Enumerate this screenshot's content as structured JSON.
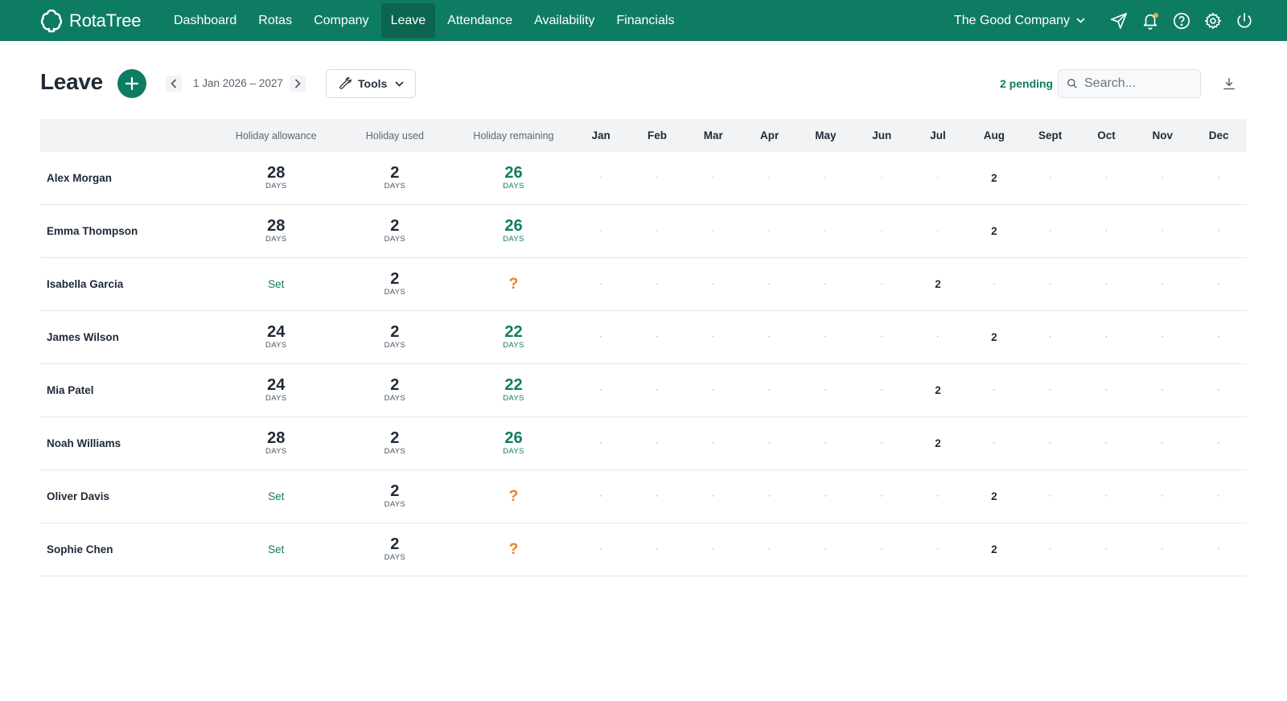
{
  "brand": {
    "name": "RotaTree"
  },
  "nav": [
    "Dashboard",
    "Rotas",
    "Company",
    "Leave",
    "Attendance",
    "Availability",
    "Financials"
  ],
  "nav_active": "Leave",
  "company": "The Good Company",
  "colors": {
    "brand": "#0e7c62",
    "accent_orange": "#e8831c",
    "notification_dot": "#f2a93b"
  },
  "page": {
    "title": "Leave",
    "period": "1 Jan 2026 – 2027",
    "tools_label": "Tools",
    "pending": "2 pending",
    "search_placeholder": "Search..."
  },
  "table": {
    "headers": {
      "allowance": "Holiday allowance",
      "used": "Holiday used",
      "remaining": "Holiday remaining"
    },
    "months": [
      "Jan",
      "Feb",
      "Mar",
      "Apr",
      "May",
      "Jun",
      "Jul",
      "Aug",
      "Sept",
      "Oct",
      "Nov",
      "Dec"
    ],
    "unit": "DAYS",
    "set_label": "Set",
    "unknown": "?",
    "empty": "·",
    "rows": [
      {
        "name": "Alex Morgan",
        "allowance": "28",
        "used": "2",
        "remaining": "26",
        "months": [
          "·",
          "·",
          "·",
          "·",
          "·",
          "·",
          "·",
          "2",
          "·",
          "·",
          "·",
          "·"
        ]
      },
      {
        "name": "Emma Thompson",
        "allowance": "28",
        "used": "2",
        "remaining": "26",
        "months": [
          "·",
          "·",
          "·",
          "·",
          "·",
          "·",
          "·",
          "2",
          "·",
          "·",
          "·",
          "·"
        ]
      },
      {
        "name": "Isabella Garcia",
        "allowance": null,
        "used": "2",
        "remaining": null,
        "months": [
          "·",
          "·",
          "·",
          "·",
          "·",
          "·",
          "2",
          "·",
          "·",
          "·",
          "·",
          "·"
        ]
      },
      {
        "name": "James Wilson",
        "allowance": "24",
        "used": "2",
        "remaining": "22",
        "months": [
          "·",
          "·",
          "·",
          "·",
          "·",
          "·",
          "·",
          "2",
          "·",
          "·",
          "·",
          "·"
        ]
      },
      {
        "name": "Mia Patel",
        "allowance": "24",
        "used": "2",
        "remaining": "22",
        "months": [
          "·",
          "·",
          "·",
          "·",
          "·",
          "·",
          "2",
          "·",
          "·",
          "·",
          "·",
          "·"
        ]
      },
      {
        "name": "Noah Williams",
        "allowance": "28",
        "used": "2",
        "remaining": "26",
        "months": [
          "·",
          "·",
          "·",
          "·",
          "·",
          "·",
          "2",
          "·",
          "·",
          "·",
          "·",
          "·"
        ]
      },
      {
        "name": "Oliver Davis",
        "allowance": null,
        "used": "2",
        "remaining": null,
        "months": [
          "·",
          "·",
          "·",
          "·",
          "·",
          "·",
          "·",
          "2",
          "·",
          "·",
          "·",
          "·"
        ]
      },
      {
        "name": "Sophie Chen",
        "allowance": null,
        "used": "2",
        "remaining": null,
        "months": [
          "·",
          "·",
          "·",
          "·",
          "·",
          "·",
          "·",
          "2",
          "·",
          "·",
          "·",
          "·"
        ]
      }
    ]
  }
}
